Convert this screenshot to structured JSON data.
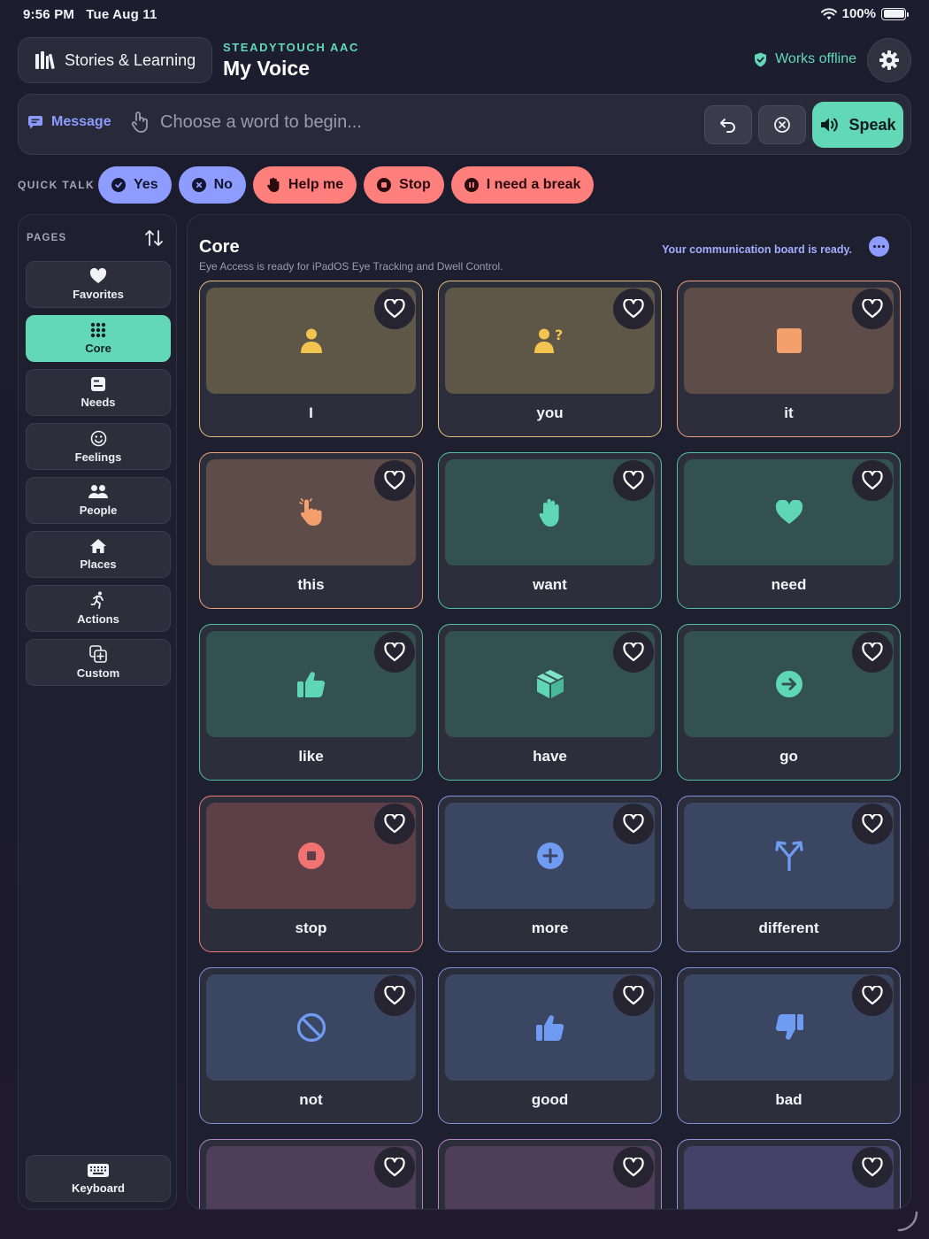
{
  "status_bar": {
    "time": "9:56 PM",
    "date": "Tue Aug 11",
    "battery": "100%"
  },
  "header": {
    "stories_label": "Stories & Learning",
    "brand_sub": "STEADYTOUCH AAC",
    "brand_title": "My Voice",
    "offline_label": "Works offline"
  },
  "message_bar": {
    "label": "Message",
    "placeholder": "Choose a word to begin...",
    "speak_label": "Speak"
  },
  "quick_talk": {
    "label": "QUICK TALK",
    "items": [
      {
        "label": "Yes",
        "tone": "blue",
        "icon": "check-circle-icon"
      },
      {
        "label": "No",
        "tone": "blue",
        "icon": "x-circle-icon"
      },
      {
        "label": "Help me",
        "tone": "red",
        "icon": "raised-hand-icon"
      },
      {
        "label": "Stop",
        "tone": "red",
        "icon": "stop-circle-icon"
      },
      {
        "label": "I need a break",
        "tone": "red",
        "icon": "pause-circle-icon"
      }
    ]
  },
  "sidebar": {
    "label": "PAGES",
    "items": [
      {
        "label": "Favorites",
        "icon": "heart-icon",
        "active": false
      },
      {
        "label": "Core",
        "icon": "grid-dots-icon",
        "active": true
      },
      {
        "label": "Needs",
        "icon": "list-card-icon",
        "active": false
      },
      {
        "label": "Feelings",
        "icon": "smiley-icon",
        "active": false
      },
      {
        "label": "People",
        "icon": "people-icon",
        "active": false
      },
      {
        "label": "Places",
        "icon": "house-icon",
        "active": false
      },
      {
        "label": "Actions",
        "icon": "running-person-icon",
        "active": false
      },
      {
        "label": "Custom",
        "icon": "plus-square-icon",
        "active": false
      }
    ],
    "keyboard_label": "Keyboard"
  },
  "board": {
    "title": "Core",
    "subtitle": "Eye Access is ready for iPadOS Eye Tracking and Dwell Control.",
    "status": "Your communication board is ready.",
    "tiles": [
      {
        "word": "I",
        "color": "yellow",
        "icon": "person-icon"
      },
      {
        "word": "you",
        "color": "yellow",
        "icon": "person-question-icon"
      },
      {
        "word": "it",
        "color": "orange",
        "icon": "square-icon"
      },
      {
        "word": "this",
        "color": "orange",
        "icon": "pointing-hand-icon"
      },
      {
        "word": "want",
        "color": "green",
        "icon": "open-hand-icon"
      },
      {
        "word": "need",
        "color": "green",
        "icon": "heart-icon"
      },
      {
        "word": "like",
        "color": "green",
        "icon": "thumbs-up-icon"
      },
      {
        "word": "have",
        "color": "green",
        "icon": "box-icon"
      },
      {
        "word": "go",
        "color": "green",
        "icon": "arrow-right-circle-icon"
      },
      {
        "word": "stop",
        "color": "red",
        "icon": "stop-circle-icon"
      },
      {
        "word": "more",
        "color": "blue",
        "icon": "plus-circle-icon"
      },
      {
        "word": "different",
        "color": "blue",
        "icon": "branch-arrow-icon"
      },
      {
        "word": "not",
        "color": "blue",
        "icon": "prohibited-icon"
      },
      {
        "word": "good",
        "color": "blue",
        "icon": "thumbs-up-icon"
      },
      {
        "word": "bad",
        "color": "blue",
        "icon": "thumbs-down-icon"
      },
      {
        "word": "",
        "color": "purple",
        "icon": "clapping-hands-icon"
      },
      {
        "word": "",
        "color": "purple",
        "icon": "check-circle-icon"
      },
      {
        "word": "",
        "color": "indigo",
        "icon": "question-circle-icon"
      }
    ]
  },
  "colors": {
    "accent": "#63d8b7",
    "quick_blue": "#8e9bff",
    "quick_red": "#ff7f7d",
    "background": "#1c1d2e"
  }
}
